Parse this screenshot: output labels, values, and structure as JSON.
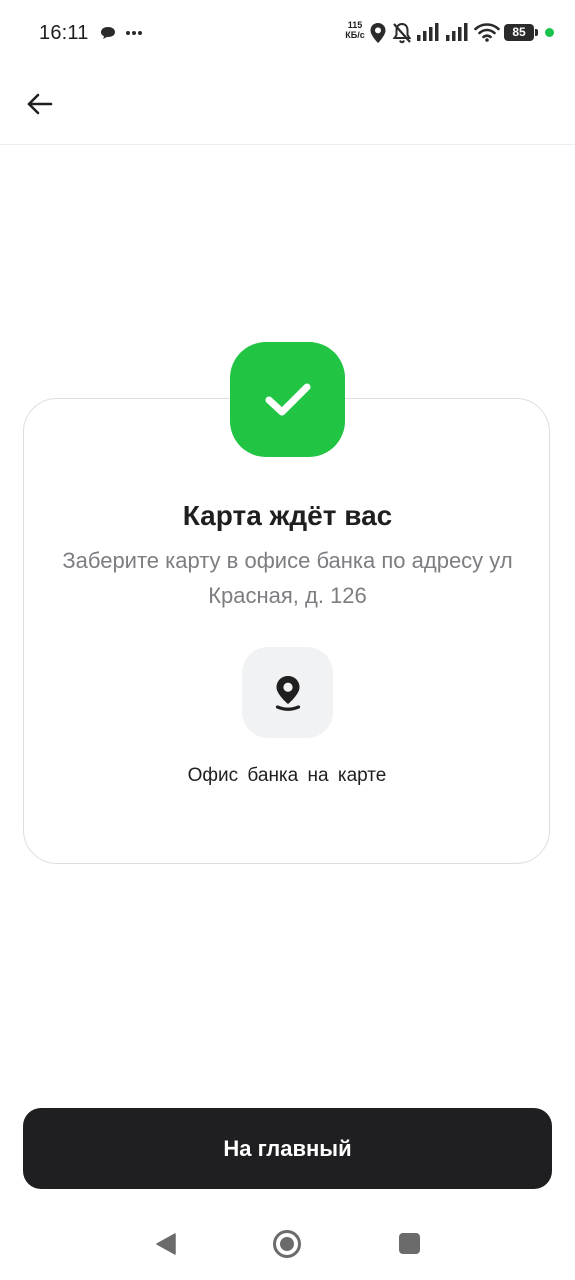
{
  "status_bar": {
    "time": "16:11",
    "network_speed_value": "115",
    "network_speed_unit": "КБ/с",
    "battery_level": "85",
    "icons": [
      "chat-bubble-icon",
      "more-dots-icon",
      "location-icon",
      "bell-off-icon",
      "signal-icon",
      "signal-icon",
      "wifi-icon",
      "battery-icon"
    ]
  },
  "app_bar": {
    "back_icon": "arrow-left-icon"
  },
  "card": {
    "title": "Карта ждёт вас",
    "description": "Заберите карту в офисе банка по адресу ул Красная, д. 126",
    "map_button": {
      "icon": "map-pin-icon",
      "label": "Офис банка на карте"
    }
  },
  "home_button": {
    "label": "На главный"
  },
  "nav_bar": {
    "buttons": [
      "nav-back-icon",
      "nav-home-icon",
      "nav-recents-icon"
    ]
  },
  "colors": {
    "success_green": "#21c443",
    "dark_button": "#1f1f21",
    "status_dot": "#19c24a",
    "muted_text": "#7d7d82",
    "icon_tile_background": "#f1f2f4"
  }
}
